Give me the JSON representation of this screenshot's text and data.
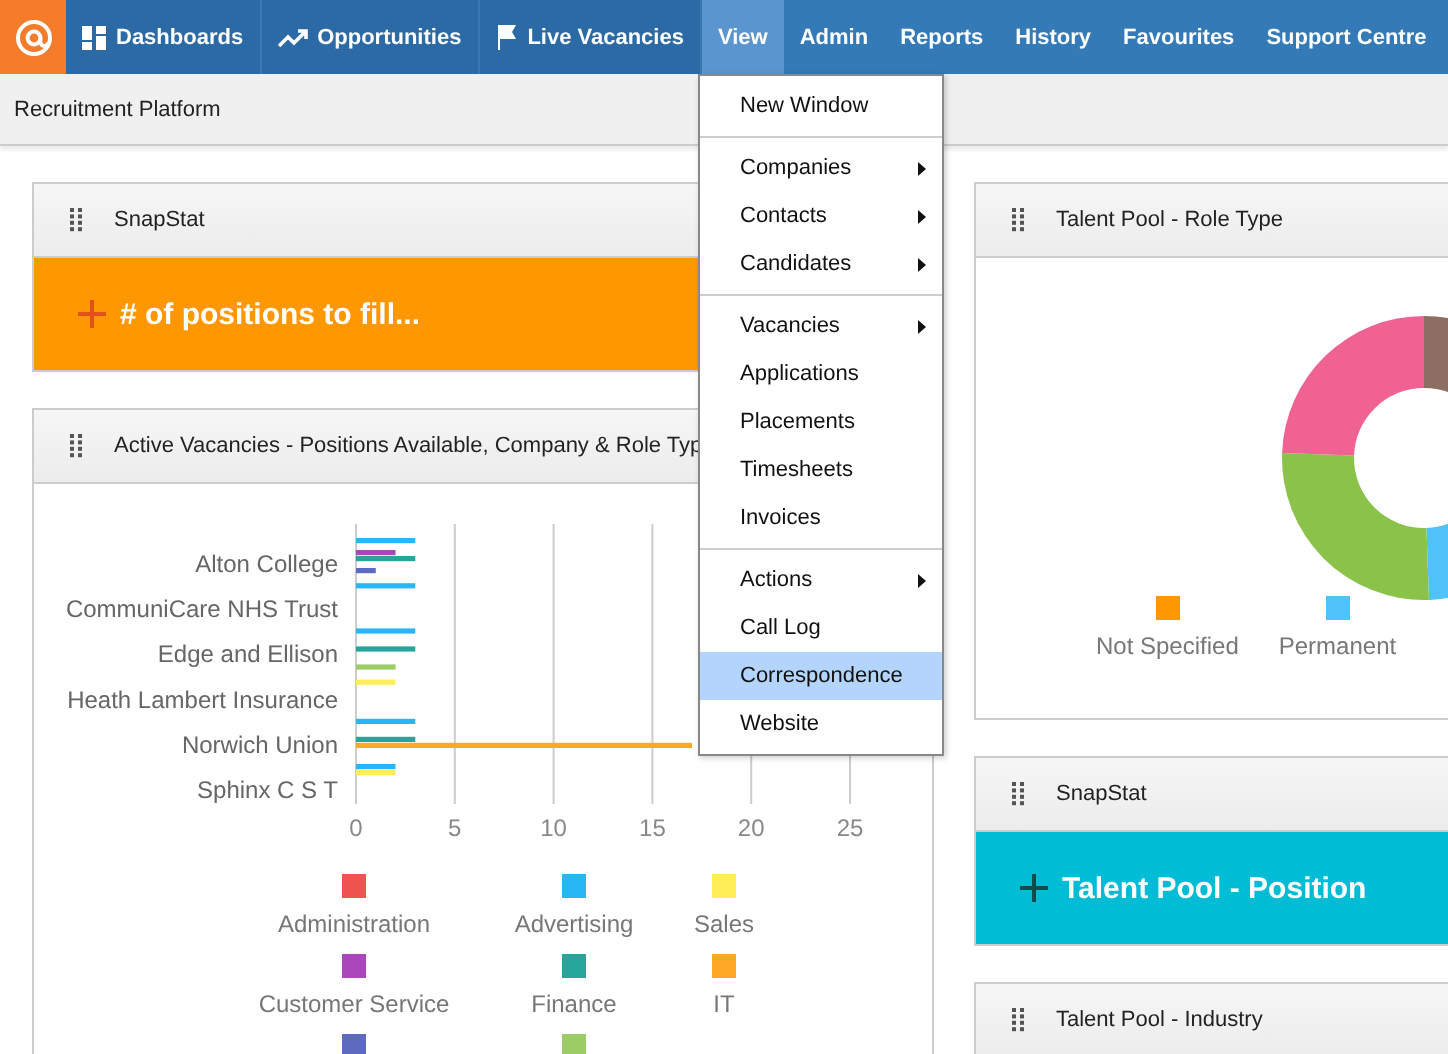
{
  "nav": {
    "items": [
      {
        "label": "Dashboards",
        "selected": false
      },
      {
        "label": "Opportunities",
        "selected": false
      },
      {
        "label": "Live Vacancies",
        "selected": false
      },
      {
        "label": "View",
        "selected": true
      },
      {
        "label": "Admin",
        "selected": false
      },
      {
        "label": "Reports",
        "selected": false
      },
      {
        "label": "History",
        "selected": false
      },
      {
        "label": "Favourites",
        "selected": false
      },
      {
        "label": "Support Centre",
        "selected": false
      }
    ]
  },
  "subheader": {
    "title": "Recruitment Platform"
  },
  "left_column": {
    "snapstat": {
      "title": "SnapStat",
      "label": "# of positions to fill...",
      "color": "#ff9800"
    },
    "vacancies_panel": {
      "title": "Active Vacancies - Positions Available, Company & Role Typ",
      "chart_data": {
        "type": "bar",
        "orientation": "horizontal",
        "categories": [
          "Alton College",
          "CommuniCare NHS Trust",
          "Edge and Ellison",
          "Heath Lambert Insurance",
          "Norwich Union",
          "Sphinx C S T"
        ],
        "xlim": [
          0,
          25
        ],
        "xticks": [
          0,
          5,
          10,
          15,
          20,
          25
        ],
        "grid": true,
        "legend": true,
        "series": [
          {
            "name": "Administration",
            "color": "#ef5350",
            "values": [
              null,
              null,
              null,
              null,
              null,
              null
            ]
          },
          {
            "name": "Advertising",
            "color": "#29b6f6",
            "values": [
              3,
              3,
              3,
              null,
              3,
              2
            ]
          },
          {
            "name": "Sales",
            "color": "#ffee58",
            "values": [
              null,
              null,
              null,
              2,
              null,
              2
            ]
          },
          {
            "name": "Customer Service",
            "color": "#ab47bc",
            "values": [
              2,
              null,
              null,
              null,
              null,
              null
            ]
          },
          {
            "name": "Finance",
            "color": "#26a69a",
            "values": [
              3,
              null,
              3,
              null,
              3,
              null
            ]
          },
          {
            "name": "IT",
            "color": "#ffa726",
            "values": [
              null,
              null,
              null,
              null,
              17,
              null
            ]
          },
          {
            "color": "#5c6bc0",
            "values": [
              1,
              null,
              null,
              null,
              null,
              null
            ]
          },
          {
            "color": "#9ccc65",
            "values": [
              null,
              null,
              2,
              null,
              null,
              null
            ]
          }
        ]
      }
    }
  },
  "right_column": {
    "role_type_panel": {
      "title": "Talent Pool - Role Type",
      "legend": [
        {
          "label": "Not Specified",
          "color": "#ff9800"
        },
        {
          "label": "Permanent",
          "color": "#4fc3f7"
        }
      ]
    },
    "snapstat": {
      "title": "SnapStat",
      "label": "Talent Pool - Position",
      "color": "#00bcd4"
    },
    "industry_panel": {
      "title": "Talent Pool - Industry"
    }
  },
  "view_menu": {
    "groups": [
      [
        {
          "label": "New Window",
          "submenu": false,
          "selected": false
        }
      ],
      [
        {
          "label": "Companies",
          "submenu": true,
          "selected": false
        },
        {
          "label": "Contacts",
          "submenu": true,
          "selected": false
        },
        {
          "label": "Candidates",
          "submenu": true,
          "selected": false
        }
      ],
      [
        {
          "label": "Vacancies",
          "submenu": true,
          "selected": false
        },
        {
          "label": "Applications",
          "submenu": false,
          "selected": false
        },
        {
          "label": "Placements",
          "submenu": false,
          "selected": false
        },
        {
          "label": "Timesheets",
          "submenu": false,
          "selected": false
        },
        {
          "label": "Invoices",
          "submenu": false,
          "selected": false
        }
      ],
      [
        {
          "label": "Actions",
          "submenu": true,
          "selected": false
        },
        {
          "label": "Call Log",
          "submenu": false,
          "selected": false
        },
        {
          "label": "Correspondence",
          "submenu": false,
          "selected": true
        },
        {
          "label": "Website",
          "submenu": false,
          "selected": false
        }
      ]
    ]
  }
}
